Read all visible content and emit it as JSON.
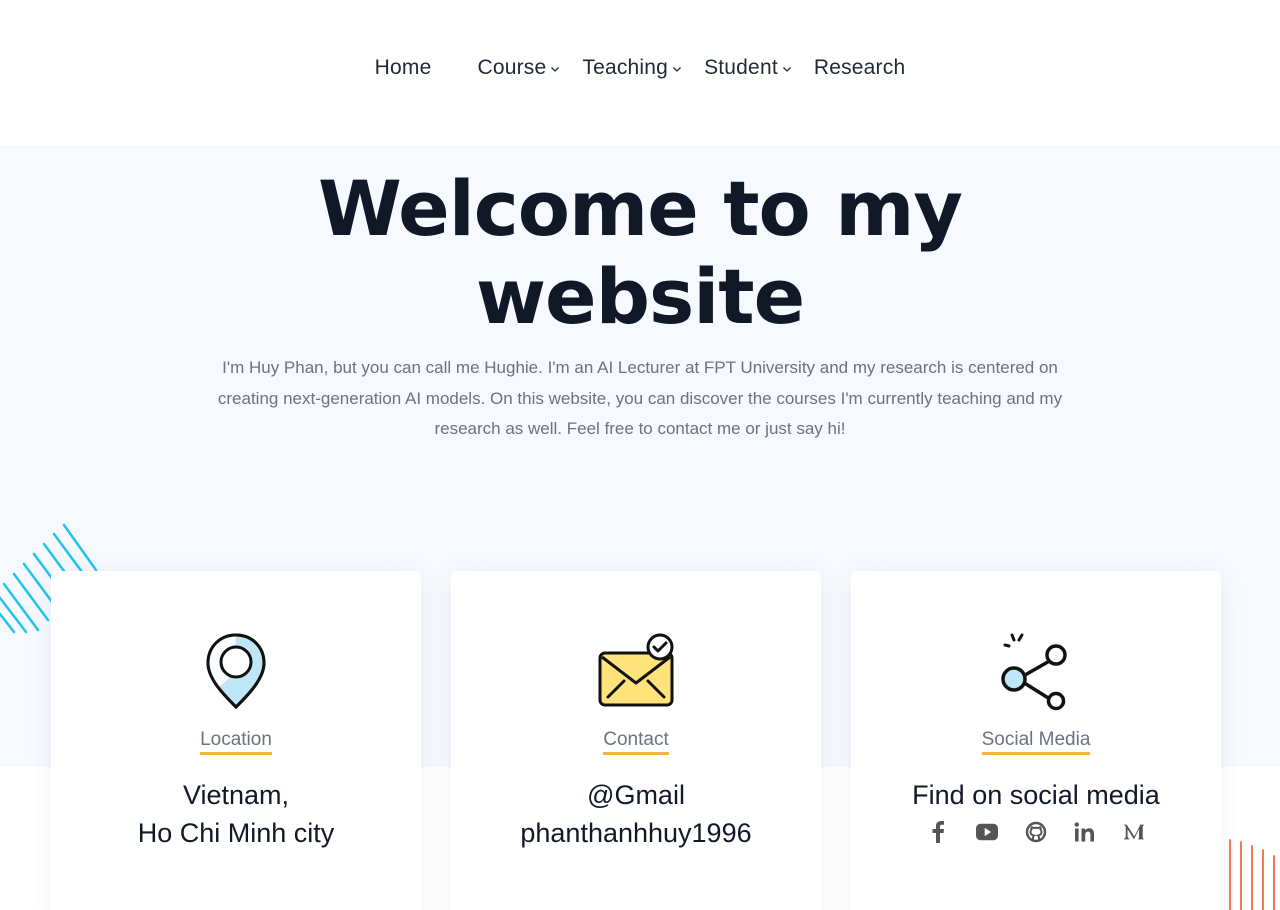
{
  "nav": {
    "items": [
      {
        "label": "Home",
        "dropdown": false
      },
      {
        "label": "Course",
        "dropdown": true
      },
      {
        "label": "Teaching",
        "dropdown": true
      },
      {
        "label": "Student",
        "dropdown": true
      },
      {
        "label": "Research",
        "dropdown": false
      }
    ]
  },
  "hero": {
    "title_line1": "Welcome to my",
    "title_line2": "website",
    "description": "I'm Huy Phan, but you can call me Hughie. I'm an AI Lecturer at FPT University and my research is centered on creating next-generation AI models. On this website, you can discover the courses I'm currently teaching and my research as well. Feel free to contact me or just say hi!"
  },
  "cards": [
    {
      "icon": "location-pin-icon",
      "label": "Location",
      "line1": "Vietnam,",
      "line2": "Ho Chi Minh city"
    },
    {
      "icon": "envelope-check-icon",
      "label": "Contact",
      "line1": "@Gmail",
      "line2": "phanthanhhuy1996"
    },
    {
      "icon": "share-icon",
      "label": "Social Media",
      "line1": "Find on social media"
    }
  ],
  "social_icons": [
    "facebook-icon",
    "youtube-icon",
    "github-icon",
    "linkedin-icon",
    "medium-icon"
  ],
  "colors": {
    "hero_bg": "#f6f9fd",
    "accent_underline": "#f5b43d",
    "deco_left": "#22c3f0",
    "deco_right": "#f07c58",
    "envelope_fill": "#ffe27a",
    "pin_fill": "#bfe6f7"
  }
}
